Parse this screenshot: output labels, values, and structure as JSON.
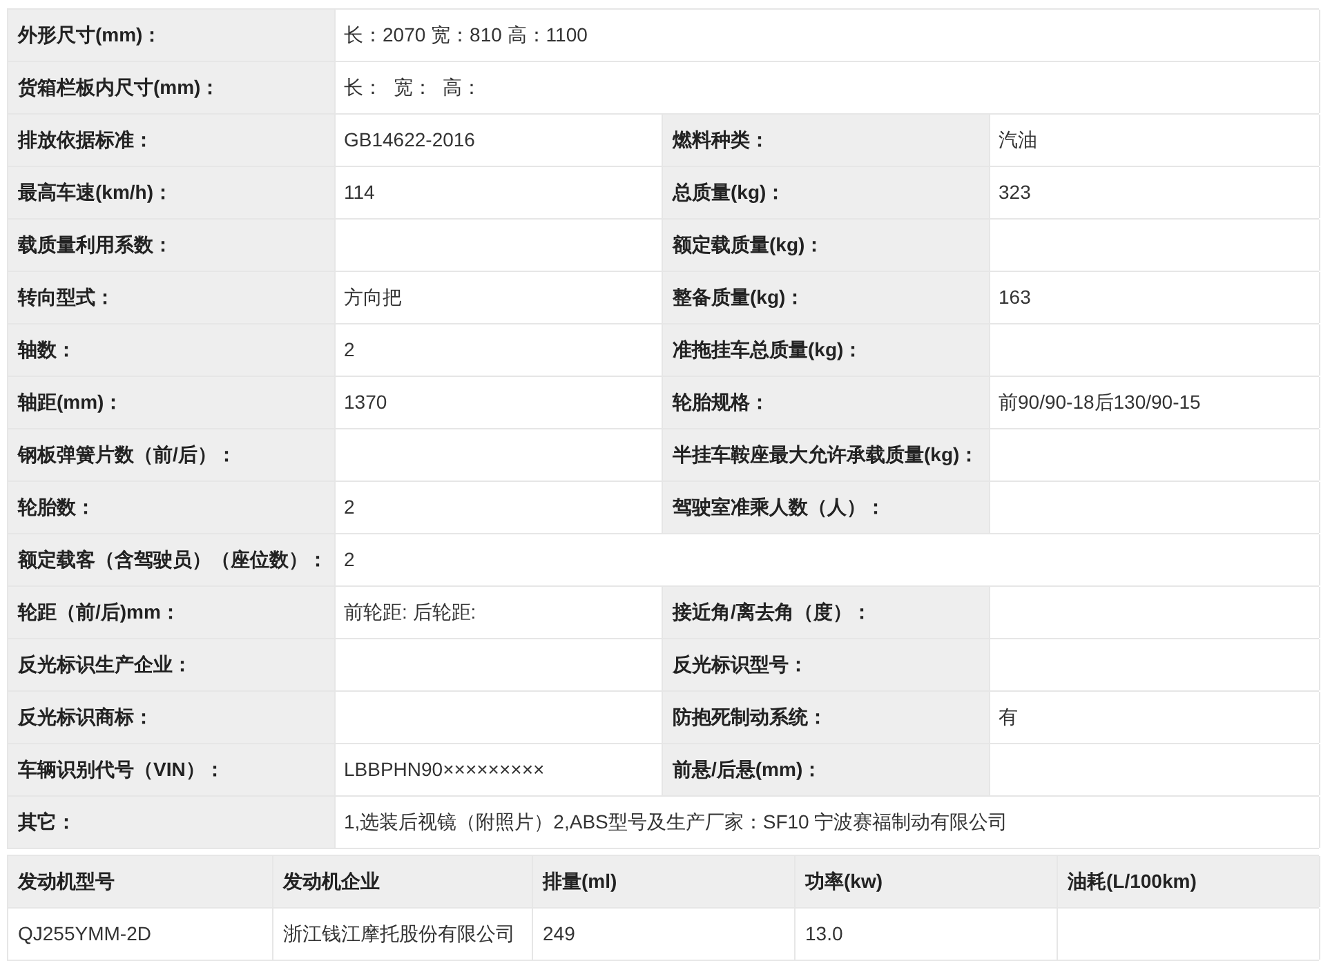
{
  "spec_rows": [
    {
      "cells": [
        {
          "label": "外形尺寸(mm)：",
          "value": "长：2070 宽：810 高：1100"
        }
      ]
    },
    {
      "cells": [
        {
          "label": "货箱栏板内尺寸(mm)：",
          "value": "长：  宽：  高："
        }
      ]
    },
    {
      "cells": [
        {
          "label": "排放依据标准：",
          "value": "GB14622-2016"
        },
        {
          "label": "燃料种类：",
          "value": "汽油"
        }
      ]
    },
    {
      "cells": [
        {
          "label": "最高车速(km/h)：",
          "value": "114"
        },
        {
          "label": "总质量(kg)：",
          "value": "323"
        }
      ]
    },
    {
      "cells": [
        {
          "label": "载质量利用系数："
        },
        {
          "label": "额定载质量(kg)："
        }
      ]
    },
    {
      "cells": [
        {
          "label": "转向型式：",
          "value": "方向把"
        },
        {
          "label": "整备质量(kg)：",
          "value": "163"
        }
      ]
    },
    {
      "cells": [
        {
          "label": "轴数：",
          "value": "2"
        },
        {
          "label": "准拖挂车总质量(kg)："
        }
      ]
    },
    {
      "cells": [
        {
          "label": "轴距(mm)：",
          "value": "1370"
        },
        {
          "label": "轮胎规格：",
          "value": "前90/90-18后130/90-15"
        }
      ]
    },
    {
      "cells": [
        {
          "label": "钢板弹簧片数（前/后）："
        },
        {
          "label": "半挂车鞍座最大允许承载质量(kg)："
        }
      ]
    },
    {
      "cells": [
        {
          "label": "轮胎数：",
          "value": "2"
        },
        {
          "label": "驾驶室准乘人数（人）："
        }
      ]
    },
    {
      "cells": [
        {
          "label": "额定载客（含驾驶员）（座位数）：",
          "value": "2"
        }
      ]
    },
    {
      "cells": [
        {
          "label": "轮距（前/后)mm：",
          "value": "前轮距: 后轮距:"
        },
        {
          "label": "接近角/离去角（度）："
        }
      ]
    },
    {
      "cells": [
        {
          "label": "反光标识生产企业："
        },
        {
          "label": "反光标识型号："
        }
      ]
    },
    {
      "cells": [
        {
          "label": "反光标识商标："
        },
        {
          "label": "防抱死制动系统：",
          "value": "有"
        }
      ]
    },
    {
      "cells": [
        {
          "label": "车辆识别代号（VIN）：",
          "value": "LBBPHN90×××××××××"
        },
        {
          "label": "前悬/后悬(mm)："
        }
      ]
    },
    {
      "cells": [
        {
          "label": "其它：",
          "value": "1,选装后视镜（附照片）2,ABS型号及生产厂家：SF10 宁波赛福制动有限公司"
        }
      ]
    }
  ],
  "engine_table": {
    "columns": [
      "发动机型号",
      "发动机企业",
      "排量(ml)",
      "功率(kw)",
      "油耗(L/100km)"
    ],
    "rows": [
      [
        "QJ255YMM-2D",
        "浙江钱江摩托股份有限公司",
        "249",
        "13.0"
      ]
    ]
  }
}
